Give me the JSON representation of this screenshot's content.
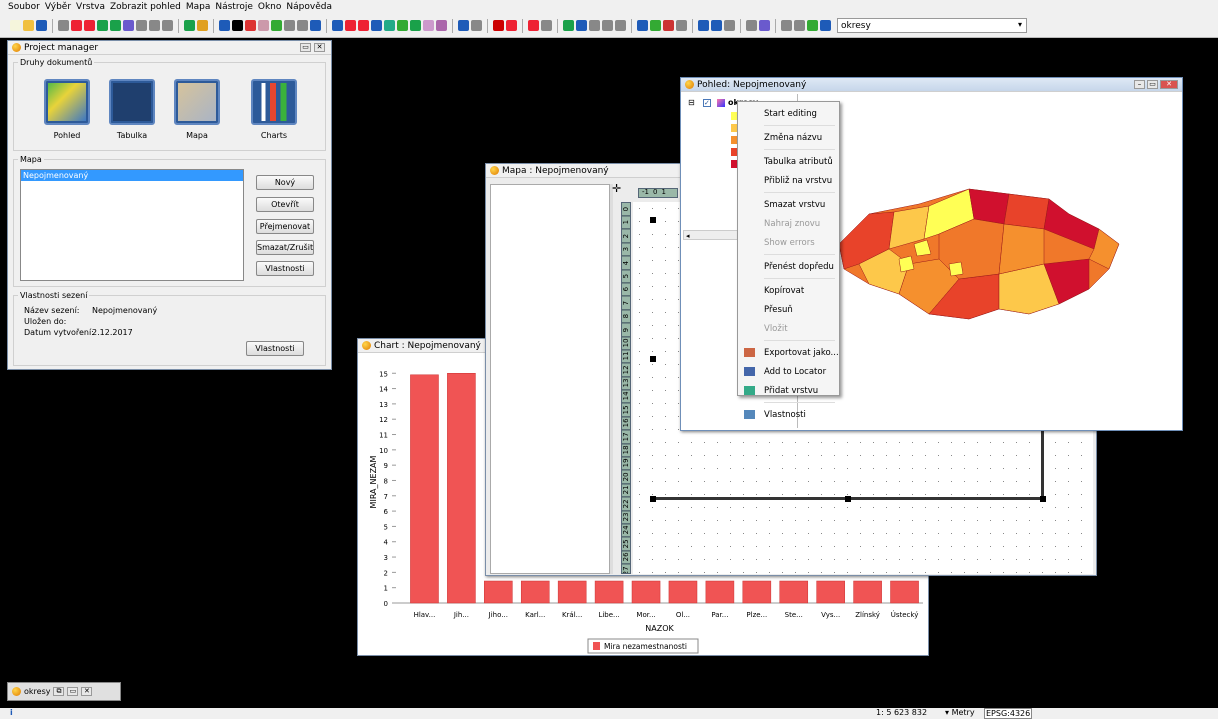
{
  "menu": [
    "Soubor",
    "Výběr",
    "Vrstva",
    "Zobrazit pohled",
    "Mapa",
    "Nástroje",
    "Okno",
    "Nápověda"
  ],
  "toolbar": {
    "layer_combo": "okresy"
  },
  "project_manager": {
    "title": "Project manager",
    "doc_types_label": "Druhy dokumentů",
    "doc_types": [
      "Pohled",
      "Tabulka",
      "Mapa",
      "Charts"
    ],
    "list_label": "Mapa",
    "list_items": [
      "Nepojmenovaný"
    ],
    "buttons": [
      "Nový",
      "Otevřít",
      "Přejmenovat",
      "Smazat/Zrušit",
      "Vlastnosti"
    ],
    "session_label": "Vlastnosti sezení",
    "session": {
      "name_label": "Název sezení:",
      "name": "Nepojmenovaný",
      "saved_label": "Uložen do:",
      "saved": "",
      "date_label": "Datum vytvoření:",
      "date": "2.12.2017"
    },
    "session_button": "Vlastnosti"
  },
  "chart_window": {
    "title": "Chart : Nepojmenovaný"
  },
  "chart_data": {
    "type": "bar",
    "categories": [
      "Hlav...",
      "Jih...",
      "Jiho...",
      "Karl...",
      "Král...",
      "Libe...",
      "Mor...",
      "Ol...",
      "Par...",
      "Plze...",
      "Ste...",
      "Vys...",
      "Zlínský",
      "Ústecký"
    ],
    "series": [
      {
        "name": "Mira nezamestnanosti",
        "values": [
          14.9,
          15.0,
          null,
          null,
          null,
          null,
          null,
          null,
          null,
          null,
          null,
          null,
          null,
          null
        ]
      }
    ],
    "xlabel": "NAZOK",
    "ylabel": "MIRA_NEZAM",
    "yticks": [
      0,
      1,
      2,
      3,
      4,
      5,
      6,
      7,
      8,
      9,
      10,
      11,
      12,
      13,
      14,
      15
    ],
    "ylim": [
      0,
      15.8
    ],
    "color": "#f05454"
  },
  "map_window": {
    "title": "Mapa : Nepojmenovaný",
    "ruler_labels": [
      "0",
      "1",
      "2",
      "3",
      "4",
      "5",
      "6",
      "7",
      "8",
      "9",
      "10",
      "11",
      "12",
      "13",
      "14",
      "15",
      "16",
      "17",
      "18",
      "19",
      "20",
      "21",
      "22",
      "23",
      "24",
      "25",
      "26",
      "27"
    ],
    "ruler_top": [
      "-1",
      "0",
      "1"
    ]
  },
  "view_window": {
    "title": "Pohled: Nepojmenovaný",
    "layer_name": "okresy",
    "scroll_left": "◂"
  },
  "context_menu": [
    {
      "label": "Start editing",
      "disabled": false,
      "sep_after": true
    },
    {
      "label": "Změna názvu",
      "disabled": false,
      "sep_after": true
    },
    {
      "label": "Tabulka atributů",
      "disabled": false,
      "sep_after": false
    },
    {
      "label": "Přibliž na vrstvu",
      "disabled": false,
      "sep_after": true
    },
    {
      "label": "Smazat vrstvu",
      "disabled": false,
      "sep_after": false
    },
    {
      "label": "Nahraj znovu",
      "disabled": true,
      "sep_after": false
    },
    {
      "label": "Show errors",
      "disabled": true,
      "sep_after": true
    },
    {
      "label": "Přenést dopředu",
      "disabled": false,
      "sep_after": true
    },
    {
      "label": "Kopírovat",
      "disabled": false,
      "sep_after": false
    },
    {
      "label": "Přesuň",
      "disabled": false,
      "sep_after": false
    },
    {
      "label": "Vložit",
      "disabled": true,
      "sep_after": true
    },
    {
      "label": "Exportovat jako...",
      "disabled": false,
      "sep_after": false,
      "icon": "export-icon"
    },
    {
      "label": "Add to Locator",
      "disabled": false,
      "sep_after": false,
      "icon": "locator-icon"
    },
    {
      "label": "Přidat vrstvu",
      "disabled": false,
      "sep_after": true,
      "icon": "add-layer-icon"
    },
    {
      "label": "Vlastnosti",
      "disabled": false,
      "sep_after": false,
      "icon": "properties-icon"
    }
  ],
  "taskbar": {
    "minimized_label": "okresy"
  },
  "status": {
    "info": "i",
    "scale": "1: 5 623 832",
    "units": "Metry",
    "crs": "EPSG:4326"
  },
  "colors": {
    "accent": "#3399ff",
    "window_border": "#7a8ea8",
    "bar": "#f05454"
  }
}
